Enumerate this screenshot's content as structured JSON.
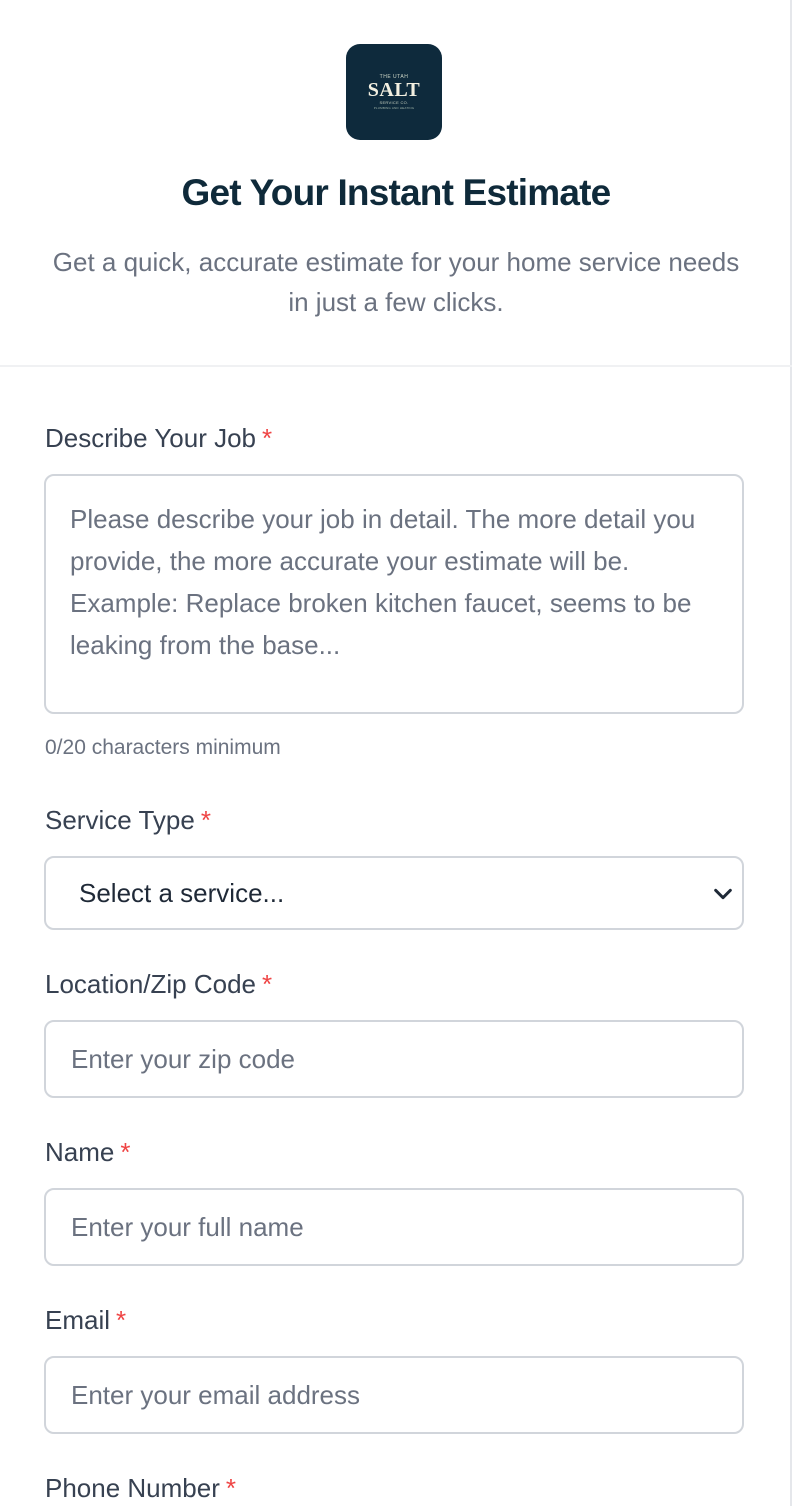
{
  "logo": {
    "top_text": "THE UTAH",
    "main_text": "SALT",
    "sub_text": "SERVICE CO.",
    "tag_text": "PLUMBING AND HEATING"
  },
  "header": {
    "title": "Get Your Instant Estimate",
    "subtitle": "Get a quick, accurate estimate for your home service needs in just a few clicks."
  },
  "form": {
    "required_marker": "*",
    "job": {
      "label": "Describe Your Job",
      "placeholder": "Please describe your job in detail. The more detail you provide, the more accurate your estimate will be. Example: Replace broken kitchen faucet, seems to be leaking from the base...",
      "helper": "0/20 characters minimum"
    },
    "service": {
      "label": "Service Type",
      "selected": "Select a service..."
    },
    "zip": {
      "label": "Location/Zip Code",
      "placeholder": "Enter your zip code"
    },
    "name": {
      "label": "Name",
      "placeholder": "Enter your full name"
    },
    "email": {
      "label": "Email",
      "placeholder": "Enter your email address"
    },
    "phone": {
      "label": "Phone Number"
    }
  },
  "colors": {
    "brand_dark": "#0e2a3c",
    "title": "#0f2a3a",
    "required": "#ef4444",
    "border": "#d1d5db"
  },
  "icons": {
    "select_arrow": "chevron-down-icon"
  }
}
